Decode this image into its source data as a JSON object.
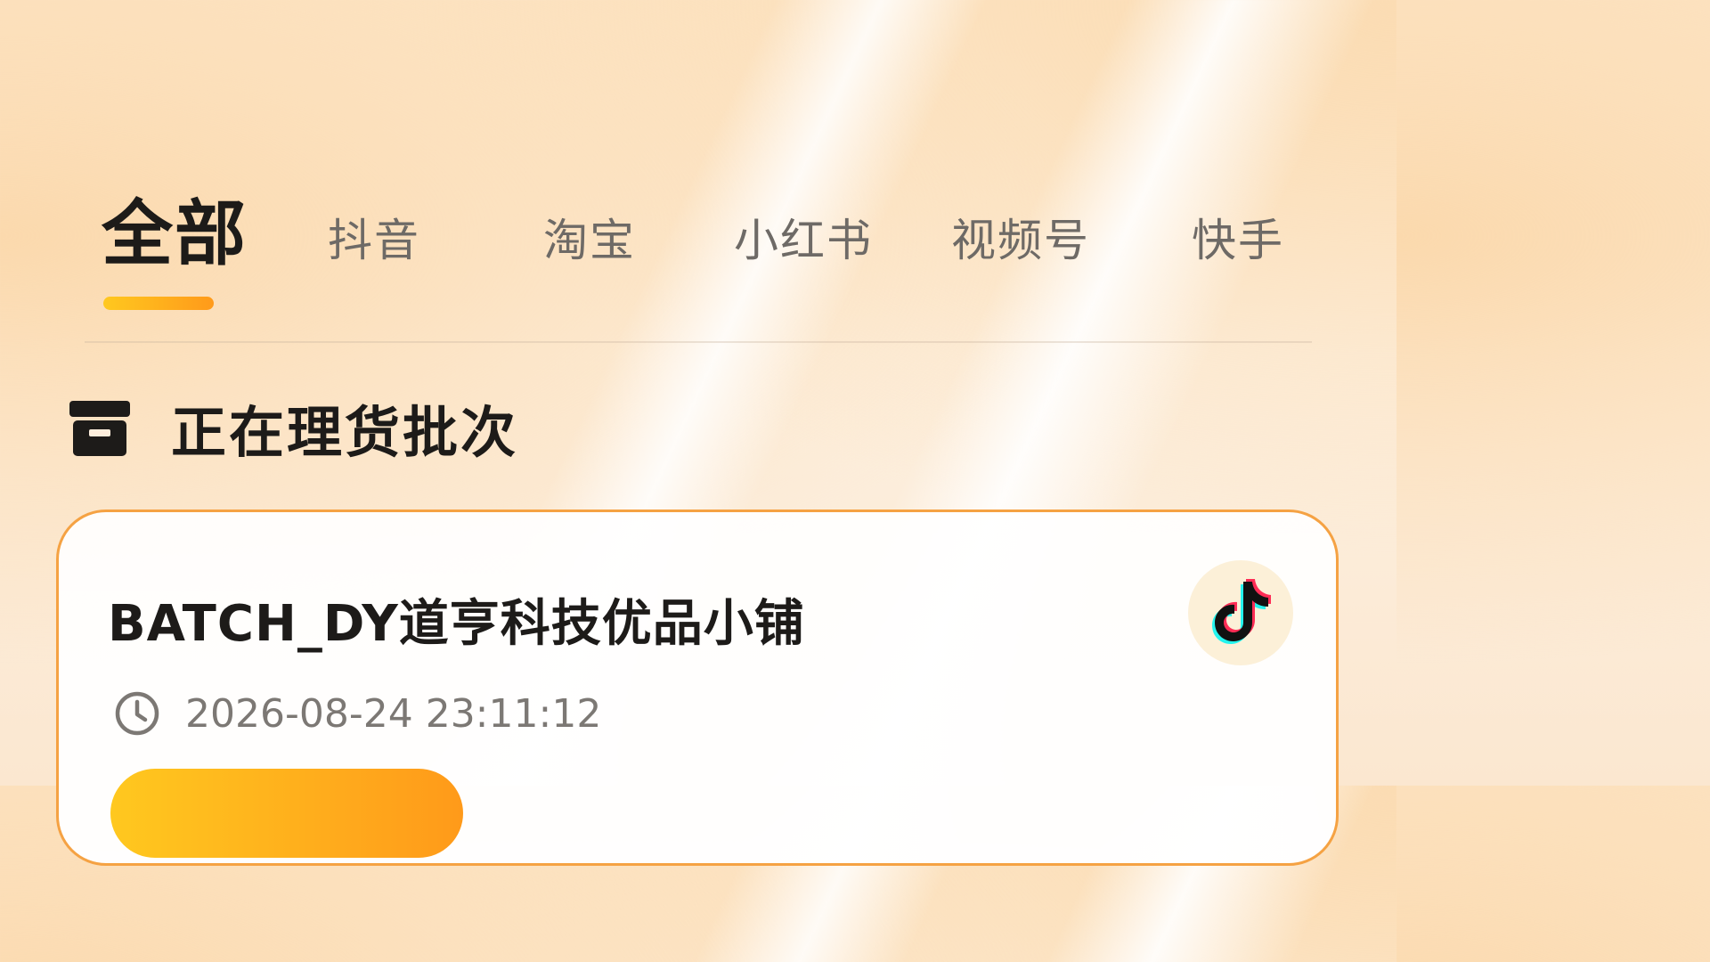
{
  "tabs": [
    {
      "label": "全部",
      "active": true
    },
    {
      "label": "抖音",
      "active": false
    },
    {
      "label": "淘宝",
      "active": false
    },
    {
      "label": "小红书",
      "active": false
    },
    {
      "label": "视频号",
      "active": false
    },
    {
      "label": "快手",
      "active": false
    }
  ],
  "section": {
    "title": "正在理货批次",
    "icon": "archive-box-icon"
  },
  "batch_card": {
    "name": "BATCH_DY道亨科技优品小铺",
    "timestamp": "2026-08-24 23:11:12",
    "platform_icon": "douyin-logo-icon",
    "time_icon": "clock-icon"
  },
  "colors": {
    "accent_start": "#ffc81f",
    "accent_end": "#ff9a1a",
    "card_border": "#f5a243",
    "text_primary": "#1d1b19",
    "text_secondary": "#6e6a66",
    "douyin_cyan": "#25f4ee",
    "douyin_red": "#fe2c55"
  }
}
